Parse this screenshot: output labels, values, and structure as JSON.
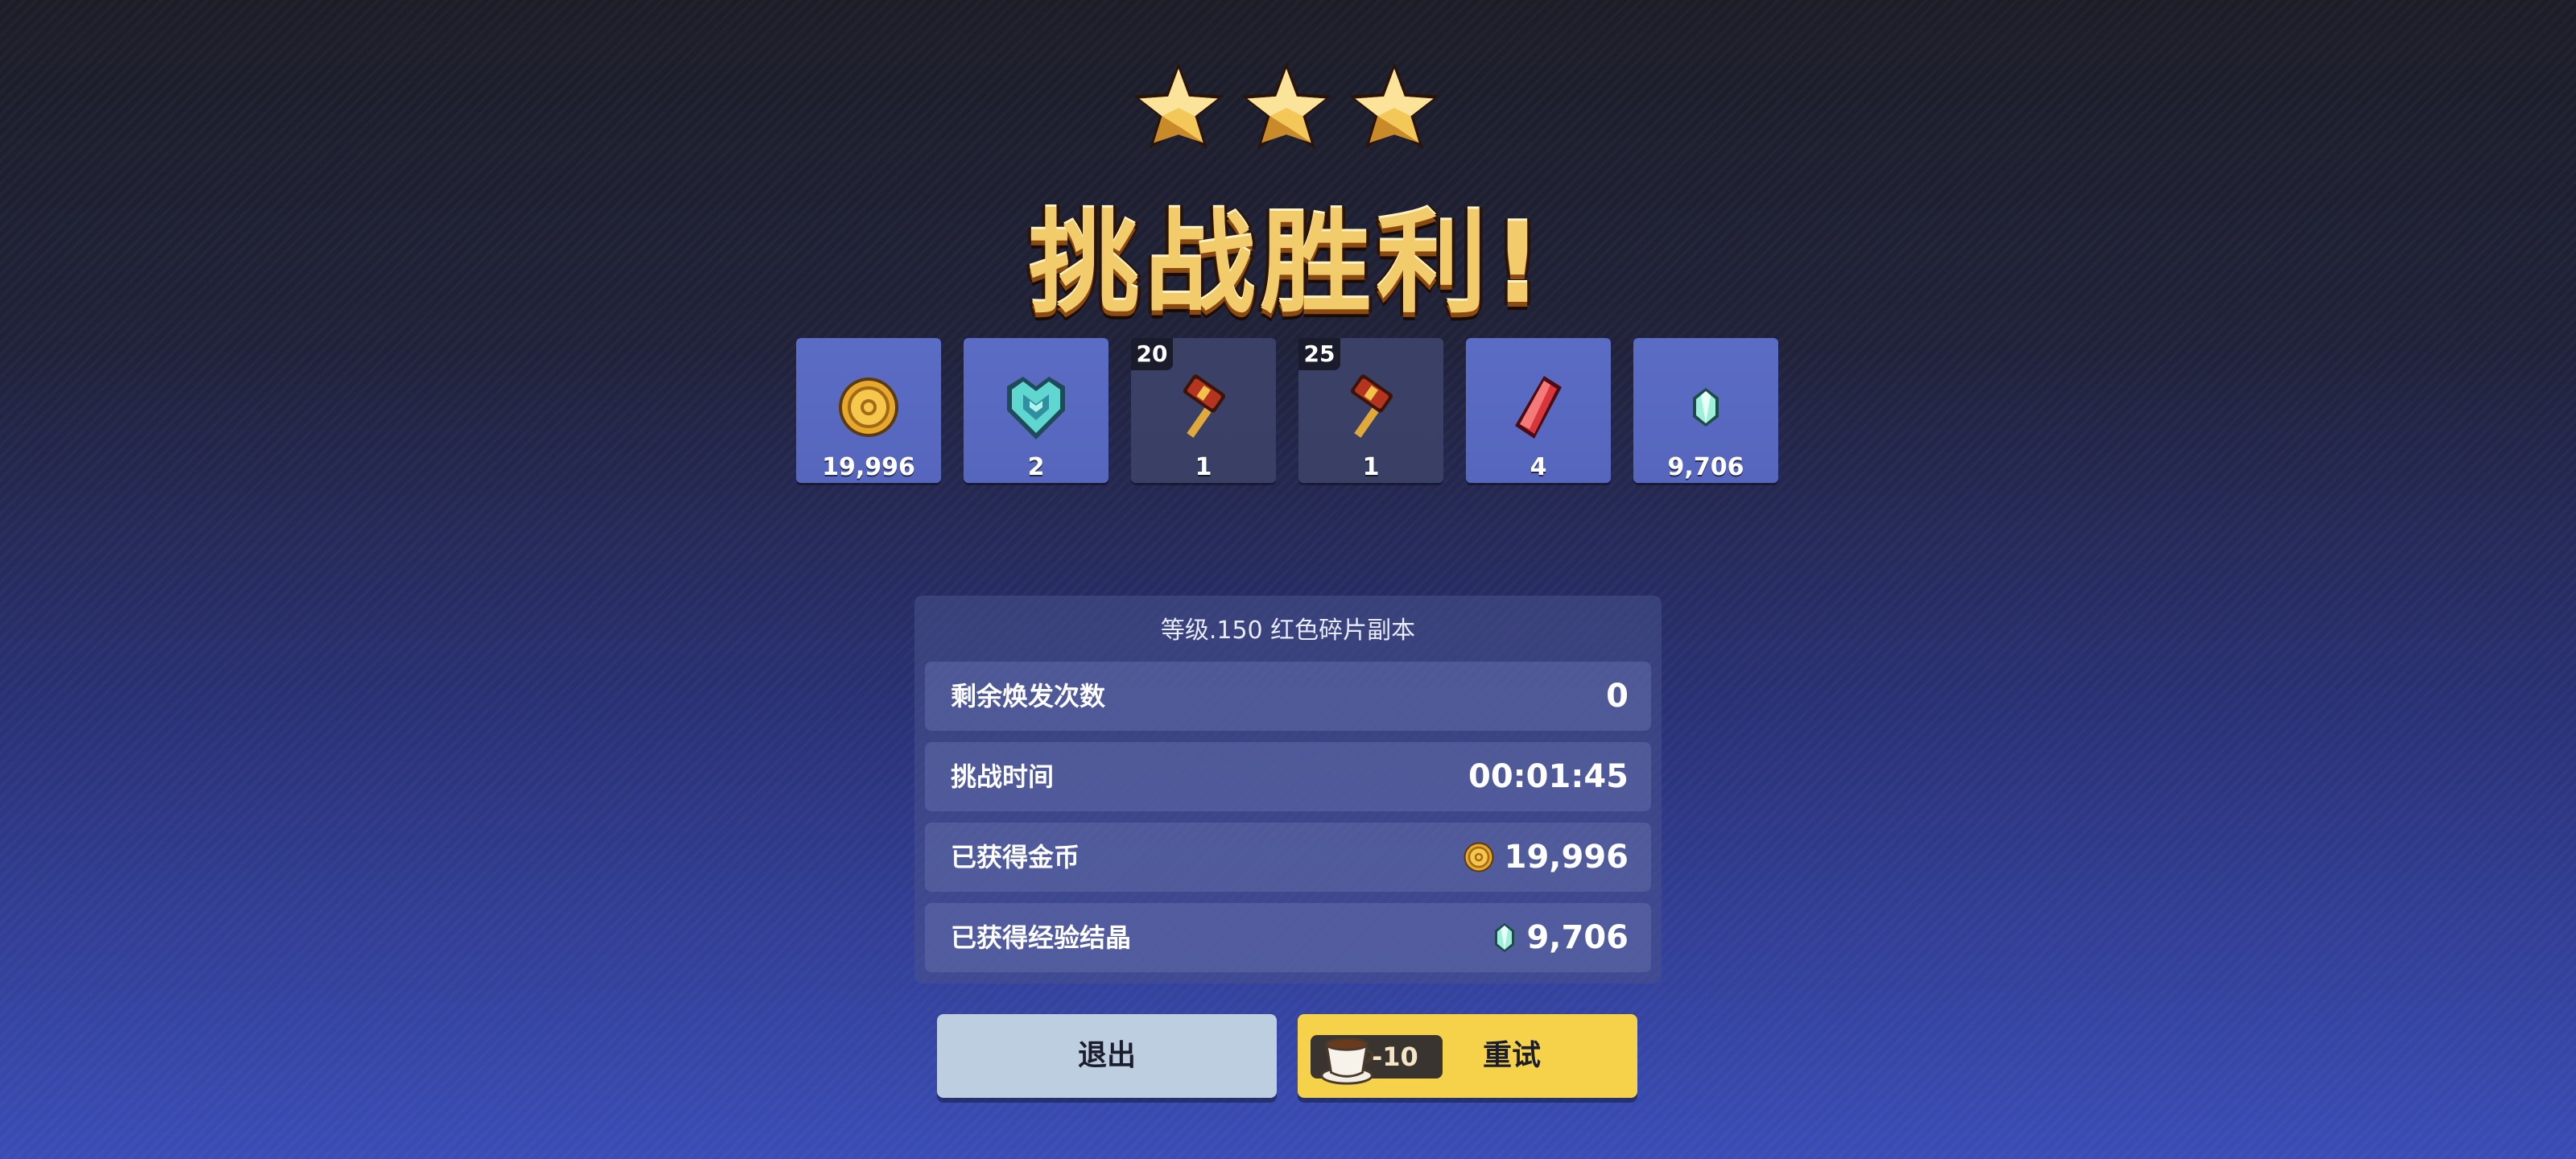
{
  "stars": {
    "earned": 3,
    "total": 3,
    "icon": "star-icon"
  },
  "title": "挑战胜利!",
  "rewards": [
    {
      "icon": "gold-coin-icon",
      "quantity": "19,996",
      "level": "",
      "bg": "blue"
    },
    {
      "icon": "teal-crest-icon",
      "quantity": "2",
      "level": "",
      "bg": "blue"
    },
    {
      "icon": "hammer-icon",
      "quantity": "1",
      "level": "20",
      "bg": "gray"
    },
    {
      "icon": "hammer-icon",
      "quantity": "1",
      "level": "25",
      "bg": "gray"
    },
    {
      "icon": "red-shard-icon",
      "quantity": "4",
      "level": "",
      "bg": "blue"
    },
    {
      "icon": "exp-crystal-icon",
      "quantity": "9,706",
      "level": "",
      "bg": "blue"
    }
  ],
  "panel": {
    "title": "等级.150  红色碎片副本",
    "rows": [
      {
        "label": "剩余焕发次数",
        "value": "0",
        "icon": ""
      },
      {
        "label": "挑战时间",
        "value": "00:01:45",
        "icon": ""
      },
      {
        "label": "已获得金币",
        "value": "19,996",
        "icon": "gold-coin-icon"
      },
      {
        "label": "已获得经验结晶",
        "value": "9,706",
        "icon": "exp-crystal-icon"
      }
    ]
  },
  "buttons": {
    "exit": "退出",
    "retry": "重试",
    "retry_cost": "-10",
    "retry_cost_icon": "coffee-cup-icon"
  },
  "colors": {
    "retry_button": "#f6d24a",
    "exit_button": "#bccee0",
    "title_gold": "#f2cc6b",
    "reward_tile_blue": "#5b6cc5",
    "reward_tile_gray": "#3b4166"
  }
}
